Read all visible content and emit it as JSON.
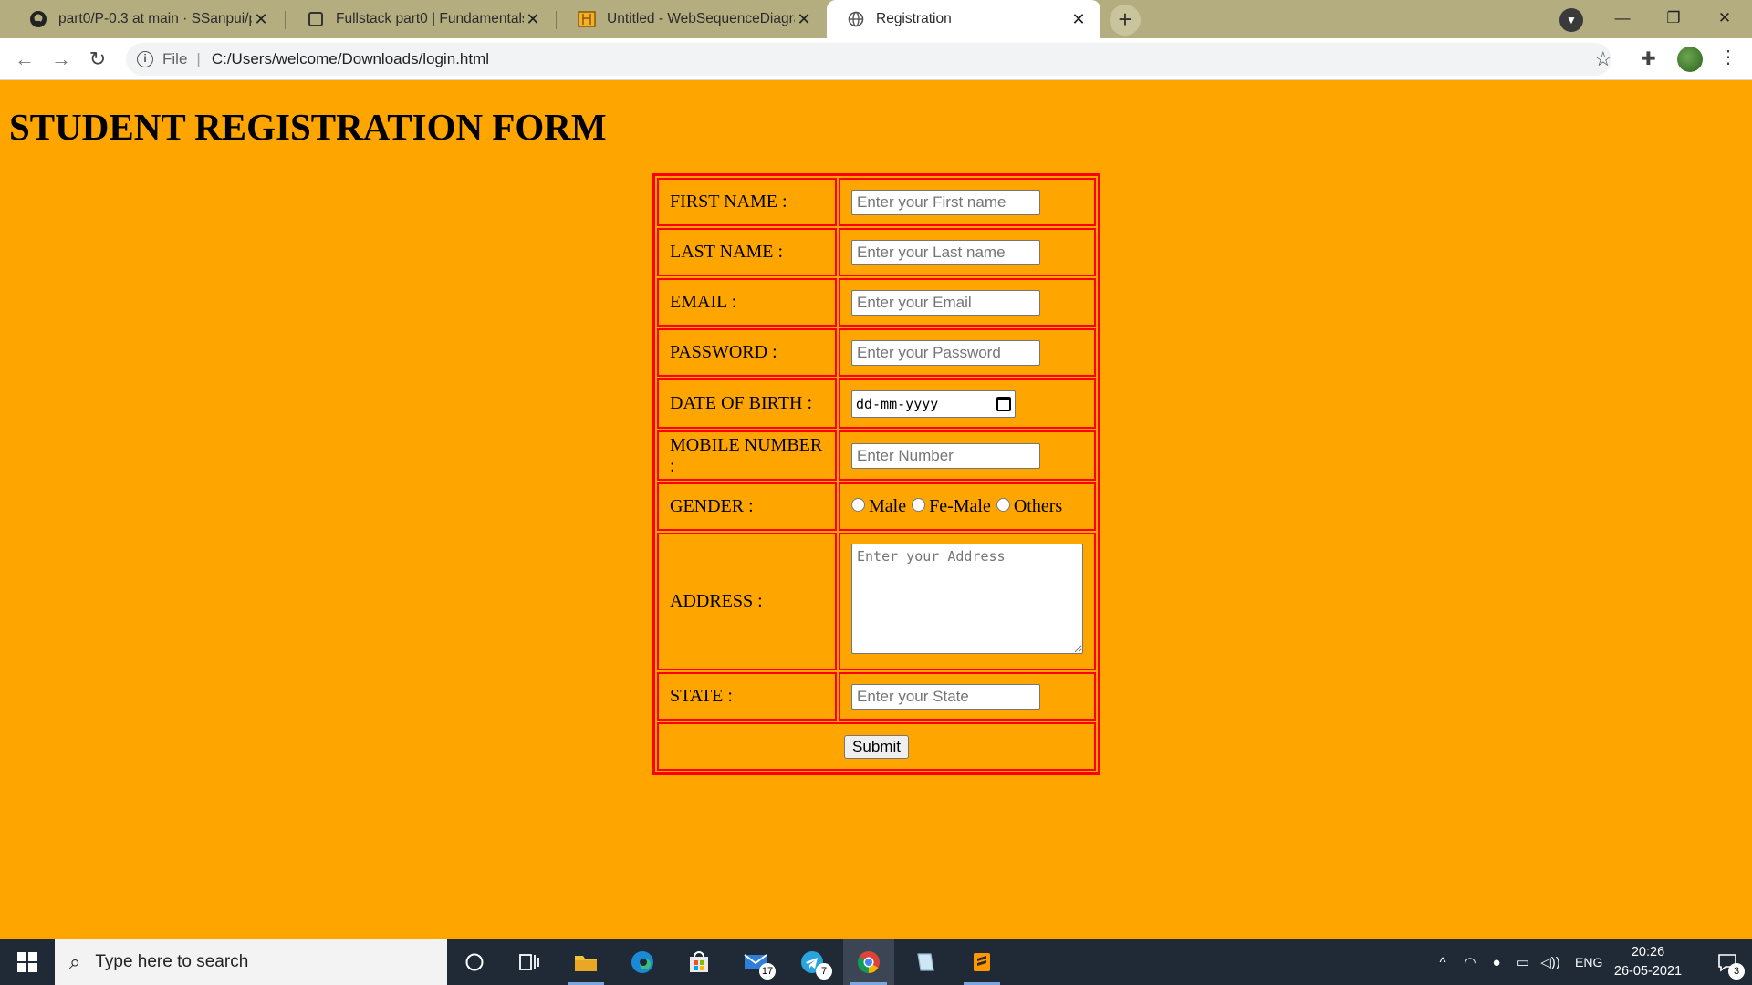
{
  "browser": {
    "tabs": [
      {
        "title": "part0/P-0.3 at main · SSanpui/pa",
        "icon": "github-icon"
      },
      {
        "title": "Fullstack part0 | Fundamentals of",
        "icon": "page-icon"
      },
      {
        "title": "Untitled - WebSequenceDiagram",
        "icon": "websequencediagrams-icon"
      },
      {
        "title": "Registration",
        "icon": "globe-icon"
      }
    ],
    "active_tab": 3,
    "address": {
      "scheme": "File",
      "url": "C:/Users/welcome/Downloads/login.html"
    }
  },
  "page": {
    "heading": "STUDENT REGISTRATION FORM",
    "labels": {
      "first_name": "FIRST NAME :",
      "last_name": "LAST NAME :",
      "email": "EMAIL :",
      "password": "PASSWORD :",
      "dob": "DATE OF BIRTH :",
      "mobile": "MOBILE NUMBER :",
      "gender": "GENDER :",
      "address": "ADDRESS :",
      "state": "STATE :"
    },
    "placeholders": {
      "first_name": "Enter your First name",
      "last_name": "Enter your Last name",
      "email": "Enter your Email",
      "password": "Enter your Password",
      "mobile": "Enter Number",
      "address": "Enter your Address",
      "state": "Enter your State"
    },
    "dob_format": "dd-mm-yyyy",
    "gender_options": [
      "Male",
      "Fe-Male",
      "Others"
    ],
    "submit_label": "Submit",
    "colors": {
      "background": "#ffa500",
      "border": "#ff0000"
    }
  },
  "taskbar": {
    "search_placeholder": "Type here to search",
    "mail_badge": "17",
    "telegram_badge": "7",
    "language": "ENG",
    "time": "20:26",
    "date": "26-05-2021",
    "notification_count": "3"
  }
}
